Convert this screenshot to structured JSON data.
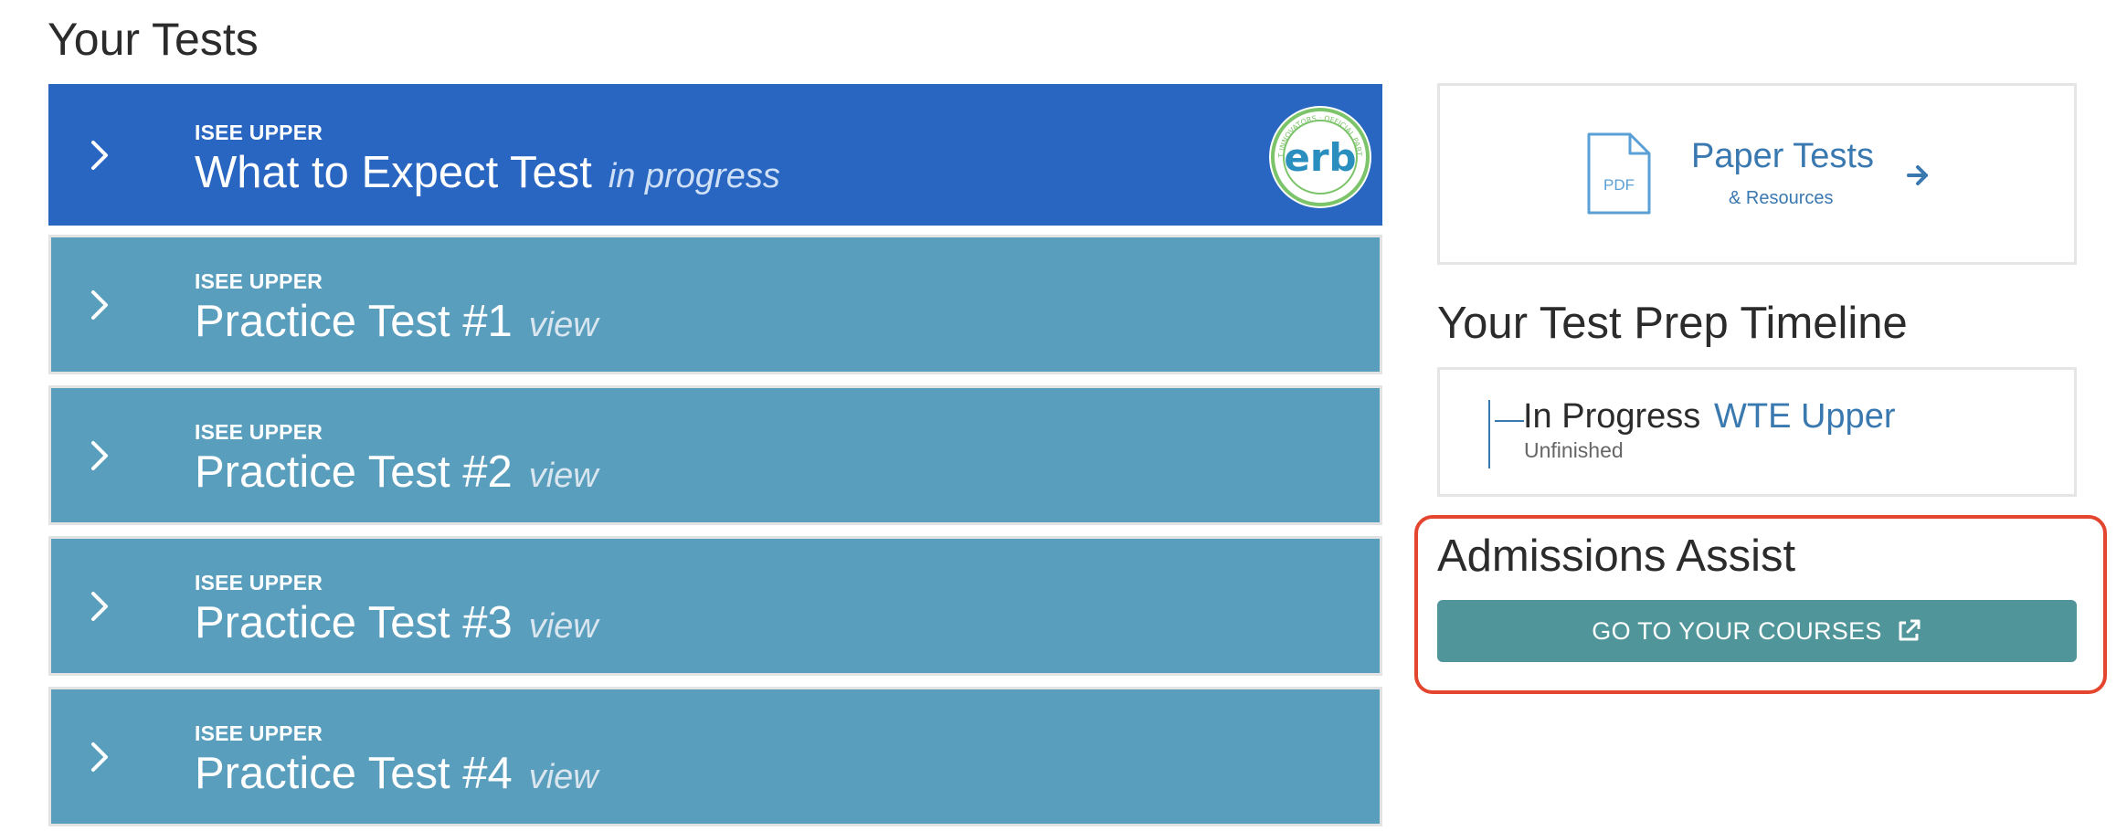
{
  "page_title": "Your Tests",
  "tests": [
    {
      "kicker": "ISEE UPPER",
      "title": "What to Expect Test",
      "status": "in progress",
      "active": true
    },
    {
      "kicker": "ISEE UPPER",
      "title": "Practice Test #1",
      "status": "view",
      "active": false
    },
    {
      "kicker": "ISEE UPPER",
      "title": "Practice Test #2",
      "status": "view",
      "active": false
    },
    {
      "kicker": "ISEE UPPER",
      "title": "Practice Test #3",
      "status": "view",
      "active": false
    },
    {
      "kicker": "ISEE UPPER",
      "title": "Practice Test #4",
      "status": "view",
      "active": false
    }
  ],
  "badge": {
    "icon": "erb-official-partner-badge",
    "letters": "erb",
    "ring_text": "TEST INNOVATORS · OFFICIAL PARTNER"
  },
  "paper_tests": {
    "icon_label": "PDF",
    "title": "Paper Tests",
    "subtitle": "& Resources"
  },
  "timeline": {
    "heading": "Your Test Prep Timeline",
    "items": [
      {
        "status": "In Progress",
        "name": "WTE Upper",
        "sub": "Unfinished"
      }
    ]
  },
  "admissions": {
    "heading": "Admissions Assist",
    "button_label": "GO TO YOUR COURSES"
  },
  "colors": {
    "active_card": "#2866c2",
    "card": "#5a9ebd",
    "link": "#3a78b0",
    "button": "#4f9599",
    "highlight": "#e3452f"
  }
}
